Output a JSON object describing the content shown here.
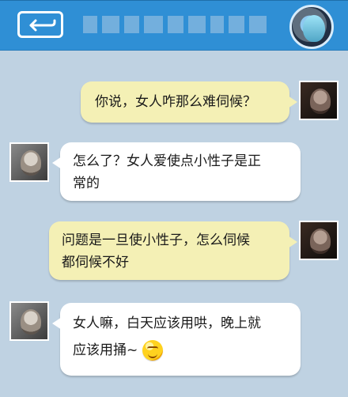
{
  "header": {
    "back_icon": "back-arrow-icon",
    "contact_name": ""
  },
  "messages": [
    {
      "side": "out",
      "text": "你说，女人咋那么难伺候？"
    },
    {
      "side": "in",
      "text_line1": "怎么了？女人爱使点小性子是正",
      "text_line2": "常的"
    },
    {
      "side": "out",
      "text_line1": "问题是一旦使小性子，怎么伺候",
      "text_line2": "都伺候不好"
    },
    {
      "side": "in",
      "text_line1": "女人嘛，白天应该用哄，晚上就",
      "text_line2": "应该用捅~",
      "emoji": "smirk-emoji-icon"
    }
  ],
  "colors": {
    "header": "#2f8fd5",
    "background": "#bfd2e2",
    "bubble_out": "#f4f0b5",
    "bubble_in": "#ffffff"
  }
}
